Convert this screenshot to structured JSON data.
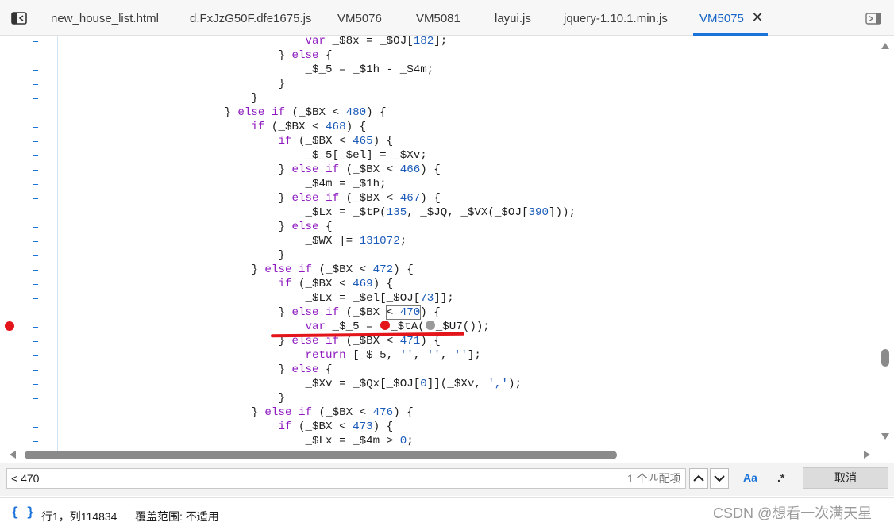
{
  "tabs": [
    {
      "label": "new_house_list.html",
      "active": false
    },
    {
      "label": "d.FxJzG50F.dfe1675.js",
      "active": false
    },
    {
      "label": "VM5076",
      "active": false
    },
    {
      "label": "VM5081",
      "active": false
    },
    {
      "label": "layui.js",
      "active": false
    },
    {
      "label": "jquery-1.10.1.min.js",
      "active": false
    },
    {
      "label": "VM5075",
      "active": true
    }
  ],
  "gutter_marker": "-",
  "code_lines": [
    "                                    var _$8x = _$OJ[182];",
    "                                } else {",
    "                                    _$_5 = _$1h - _$4m;",
    "                                }",
    "                            }",
    "                        } else if (_$BX < 480) {",
    "                            if (_$BX < 468) {",
    "                                if (_$BX < 465) {",
    "                                    _$_5[_$el] = _$Xv;",
    "                                } else if (_$BX < 466) {",
    "                                    _$4m = _$1h;",
    "                                } else if (_$BX < 467) {",
    "                                    _$Lx = _$tP(135, _$JQ, _$VX(_$OJ[390]));",
    "                                } else {",
    "                                    _$WX |= 131072;",
    "                                }",
    "                            } else if (_$BX < 472) {",
    "                                if (_$BX < 469) {",
    "                                    _$Lx = _$el[_$OJ[73]];",
    "                                } else if (_$BX < 470) {",
    "                                    var _$_5 = _$tA(_$U7());",
    "                                } else if (_$BX < 471) {",
    "                                    return [_$_5, '', '', ''];",
    "                                } else {",
    "                                    _$Xv = _$Qx[_$OJ[0]](_$Xv, ',');",
    "                                }",
    "                            } else if (_$BX < 476) {",
    "                                if (_$BX < 473) {",
    "                                    _$Lx = _$4m > 0;"
  ],
  "search": {
    "query": "< 470",
    "match_count": "1 个匹配项",
    "aa_label": "Aa",
    "regex_label": ".*",
    "cancel_label": "取消"
  },
  "status": {
    "braces": "{ }",
    "position": "行1，列114834",
    "coverage": "覆盖范围: 不适用"
  },
  "watermark": "CSDN @想看一次满天星",
  "colors": {
    "accent": "#1a73d9",
    "breakpoint": "#e3151a",
    "keyword": "#8e1abf",
    "number": "#1a5ab8"
  }
}
